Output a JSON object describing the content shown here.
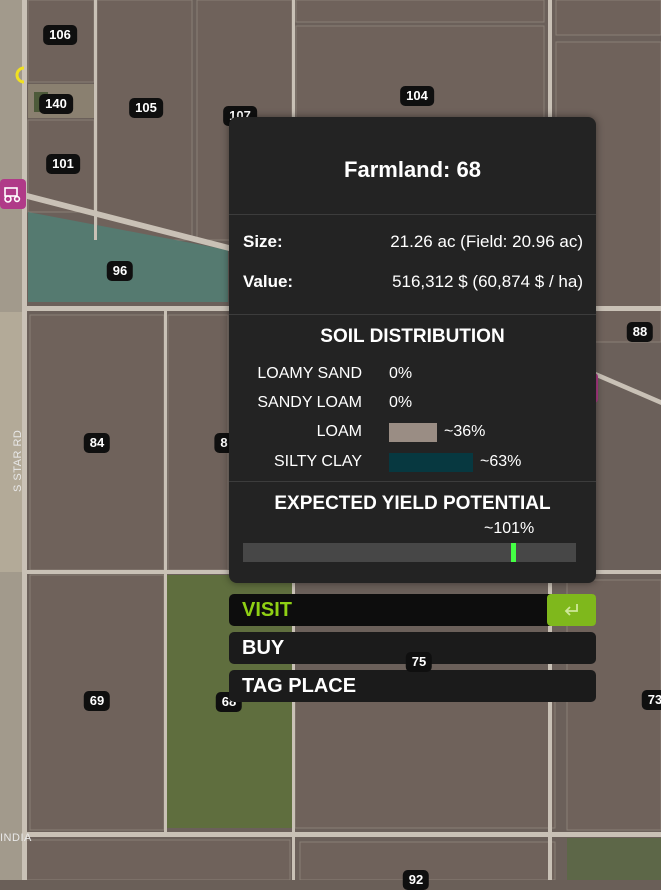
{
  "map": {
    "field_labels": [
      "106",
      "140",
      "105",
      "104",
      "101",
      "96",
      "84",
      "88",
      "69",
      "68",
      "75",
      "107",
      "8",
      "73",
      "92"
    ],
    "road_labels": [
      "S STAR RD",
      "INDIA"
    ]
  },
  "panel": {
    "title": "Farmland: 68",
    "size_label": "Size:",
    "size_value": "21.26 ac (Field: 20.96 ac)",
    "value_label": "Value:",
    "value_value": "516,312 $ (60,874 $ / ha)",
    "soil_heading": "SOIL DISTRIBUTION",
    "soils": [
      {
        "name": "LOAMY SAND",
        "pct": "0%",
        "fraction": 0,
        "color": ""
      },
      {
        "name": "SANDY LOAM",
        "pct": "0%",
        "fraction": 0,
        "color": ""
      },
      {
        "name": "LOAM",
        "pct": "~36%",
        "fraction": 0.36,
        "color": "#9a8d84"
      },
      {
        "name": "SILTY CLAY",
        "pct": "~63%",
        "fraction": 0.63,
        "color": "#073840"
      }
    ],
    "yield_heading": "EXPECTED YIELD POTENTIAL",
    "yield_pct": "~101%",
    "yield_fraction": 0.81,
    "yield_marker_color": "#44ff44"
  },
  "menu": {
    "visit": "VISIT",
    "buy": "BUY",
    "tag_place": "TAG PLACE",
    "accent_color": "#8fd014",
    "enter_key_icon": "enter-key-icon"
  }
}
